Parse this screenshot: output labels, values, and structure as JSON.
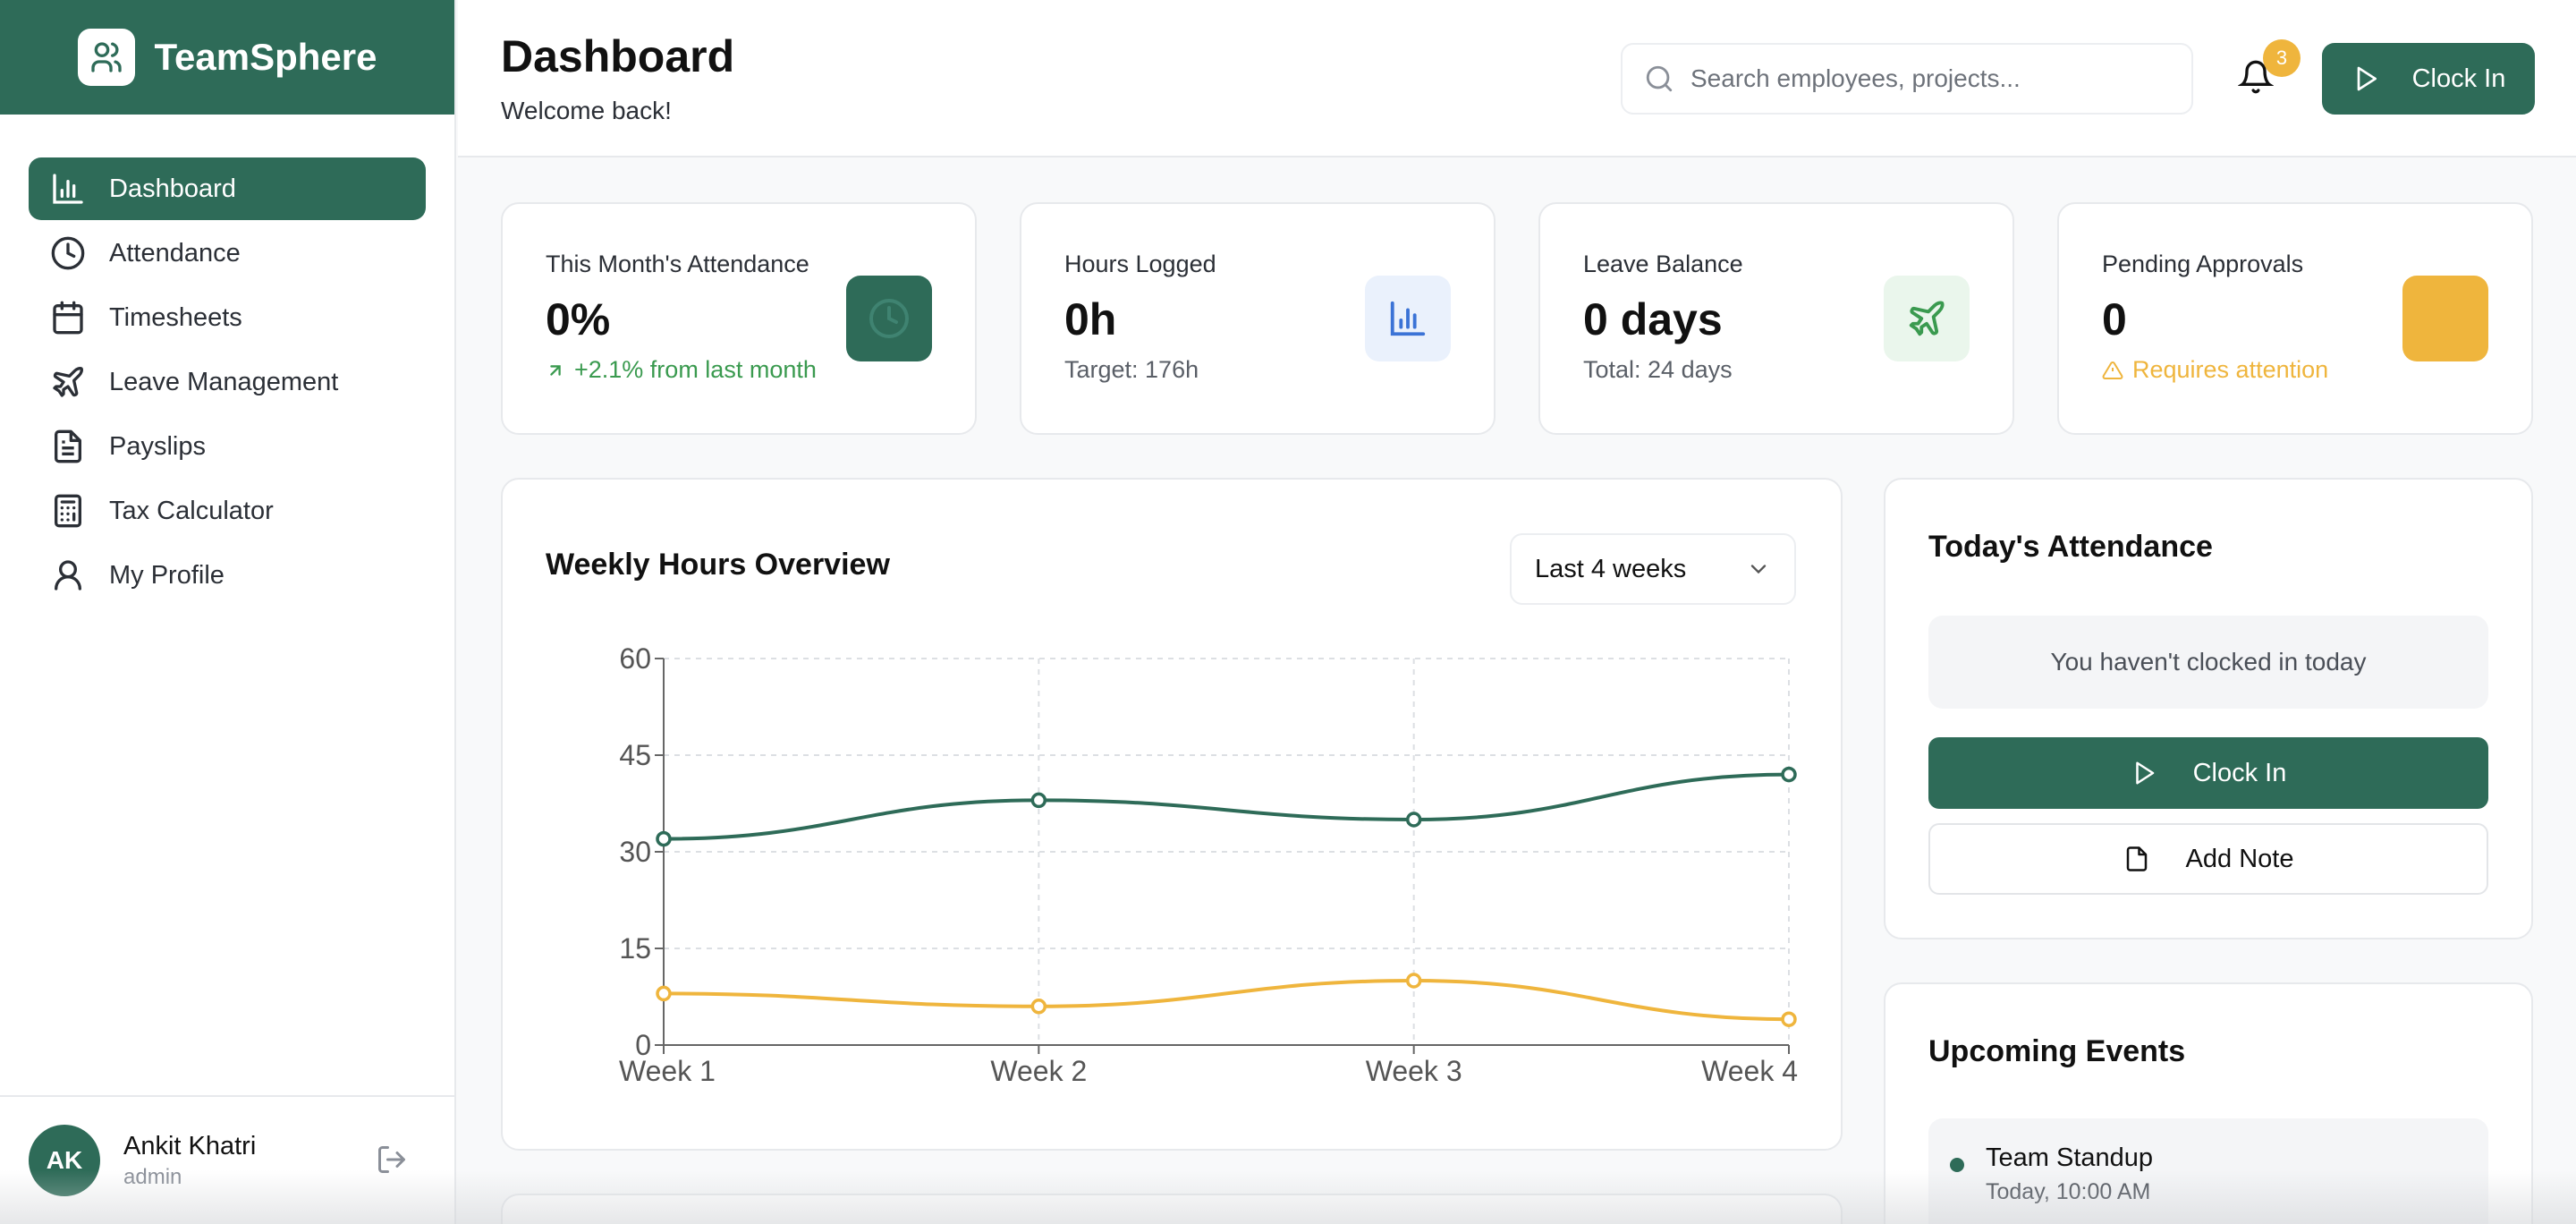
{
  "app": {
    "name": "TeamSphere"
  },
  "sidebar": {
    "items": [
      {
        "label": "Dashboard",
        "icon": "bar-chart-icon",
        "active": true
      },
      {
        "label": "Attendance",
        "icon": "clock-icon"
      },
      {
        "label": "Timesheets",
        "icon": "calendar-icon"
      },
      {
        "label": "Leave Management",
        "icon": "plane-icon"
      },
      {
        "label": "Payslips",
        "icon": "file-text-icon"
      },
      {
        "label": "Tax Calculator",
        "icon": "calculator-icon"
      },
      {
        "label": "My Profile",
        "icon": "user-icon"
      }
    ],
    "user": {
      "initials": "AK",
      "name": "Ankit Khatri",
      "role": "admin"
    }
  },
  "header": {
    "title": "Dashboard",
    "subtitle": "Welcome back!",
    "search_placeholder": "Search employees, projects...",
    "notification_count": "3",
    "clock_in_label": "Clock In"
  },
  "stats": [
    {
      "label": "This Month's Attendance",
      "value": "0%",
      "sub": "+2.1% from last month",
      "sub_color": "#3a9a4f",
      "icon": "clock-icon",
      "icon_bg": "#2e6b58"
    },
    {
      "label": "Hours Logged",
      "value": "0h",
      "sub": "Target: 176h",
      "icon": "bar-chart-icon",
      "icon_bg": "#eaf1fc"
    },
    {
      "label": "Leave Balance",
      "value": "0 days",
      "sub": "Total: 24 days",
      "icon": "plane-icon",
      "icon_bg": "#eaf6ec"
    },
    {
      "label": "Pending Approvals",
      "value": "0",
      "sub": "Requires attention",
      "sub_color": "#efb53d",
      "icon": "alert-icon",
      "icon_bg": "#efb53d"
    }
  ],
  "weekly": {
    "title": "Weekly Hours Overview",
    "range": "Last 4 weeks"
  },
  "chart_data": {
    "type": "line",
    "categories": [
      "Week 1",
      "Week 2",
      "Week 3",
      "Week 4"
    ],
    "ylim": [
      0,
      60
    ],
    "yticks": [
      0,
      15,
      30,
      45,
      60
    ],
    "grid": true,
    "series": [
      {
        "values": [
          32,
          38,
          35,
          42
        ],
        "color": "#2e6b58"
      },
      {
        "values": [
          8,
          6,
          10,
          4
        ],
        "color": "#efb53d"
      }
    ]
  },
  "today": {
    "title": "Today's Attendance",
    "status": "You haven't clocked in today",
    "clock_in_label": "Clock In",
    "add_note_label": "Add Note"
  },
  "events": {
    "title": "Upcoming Events",
    "items": [
      {
        "title": "Team Standup",
        "time": "Today, 10:00 AM"
      }
    ]
  }
}
